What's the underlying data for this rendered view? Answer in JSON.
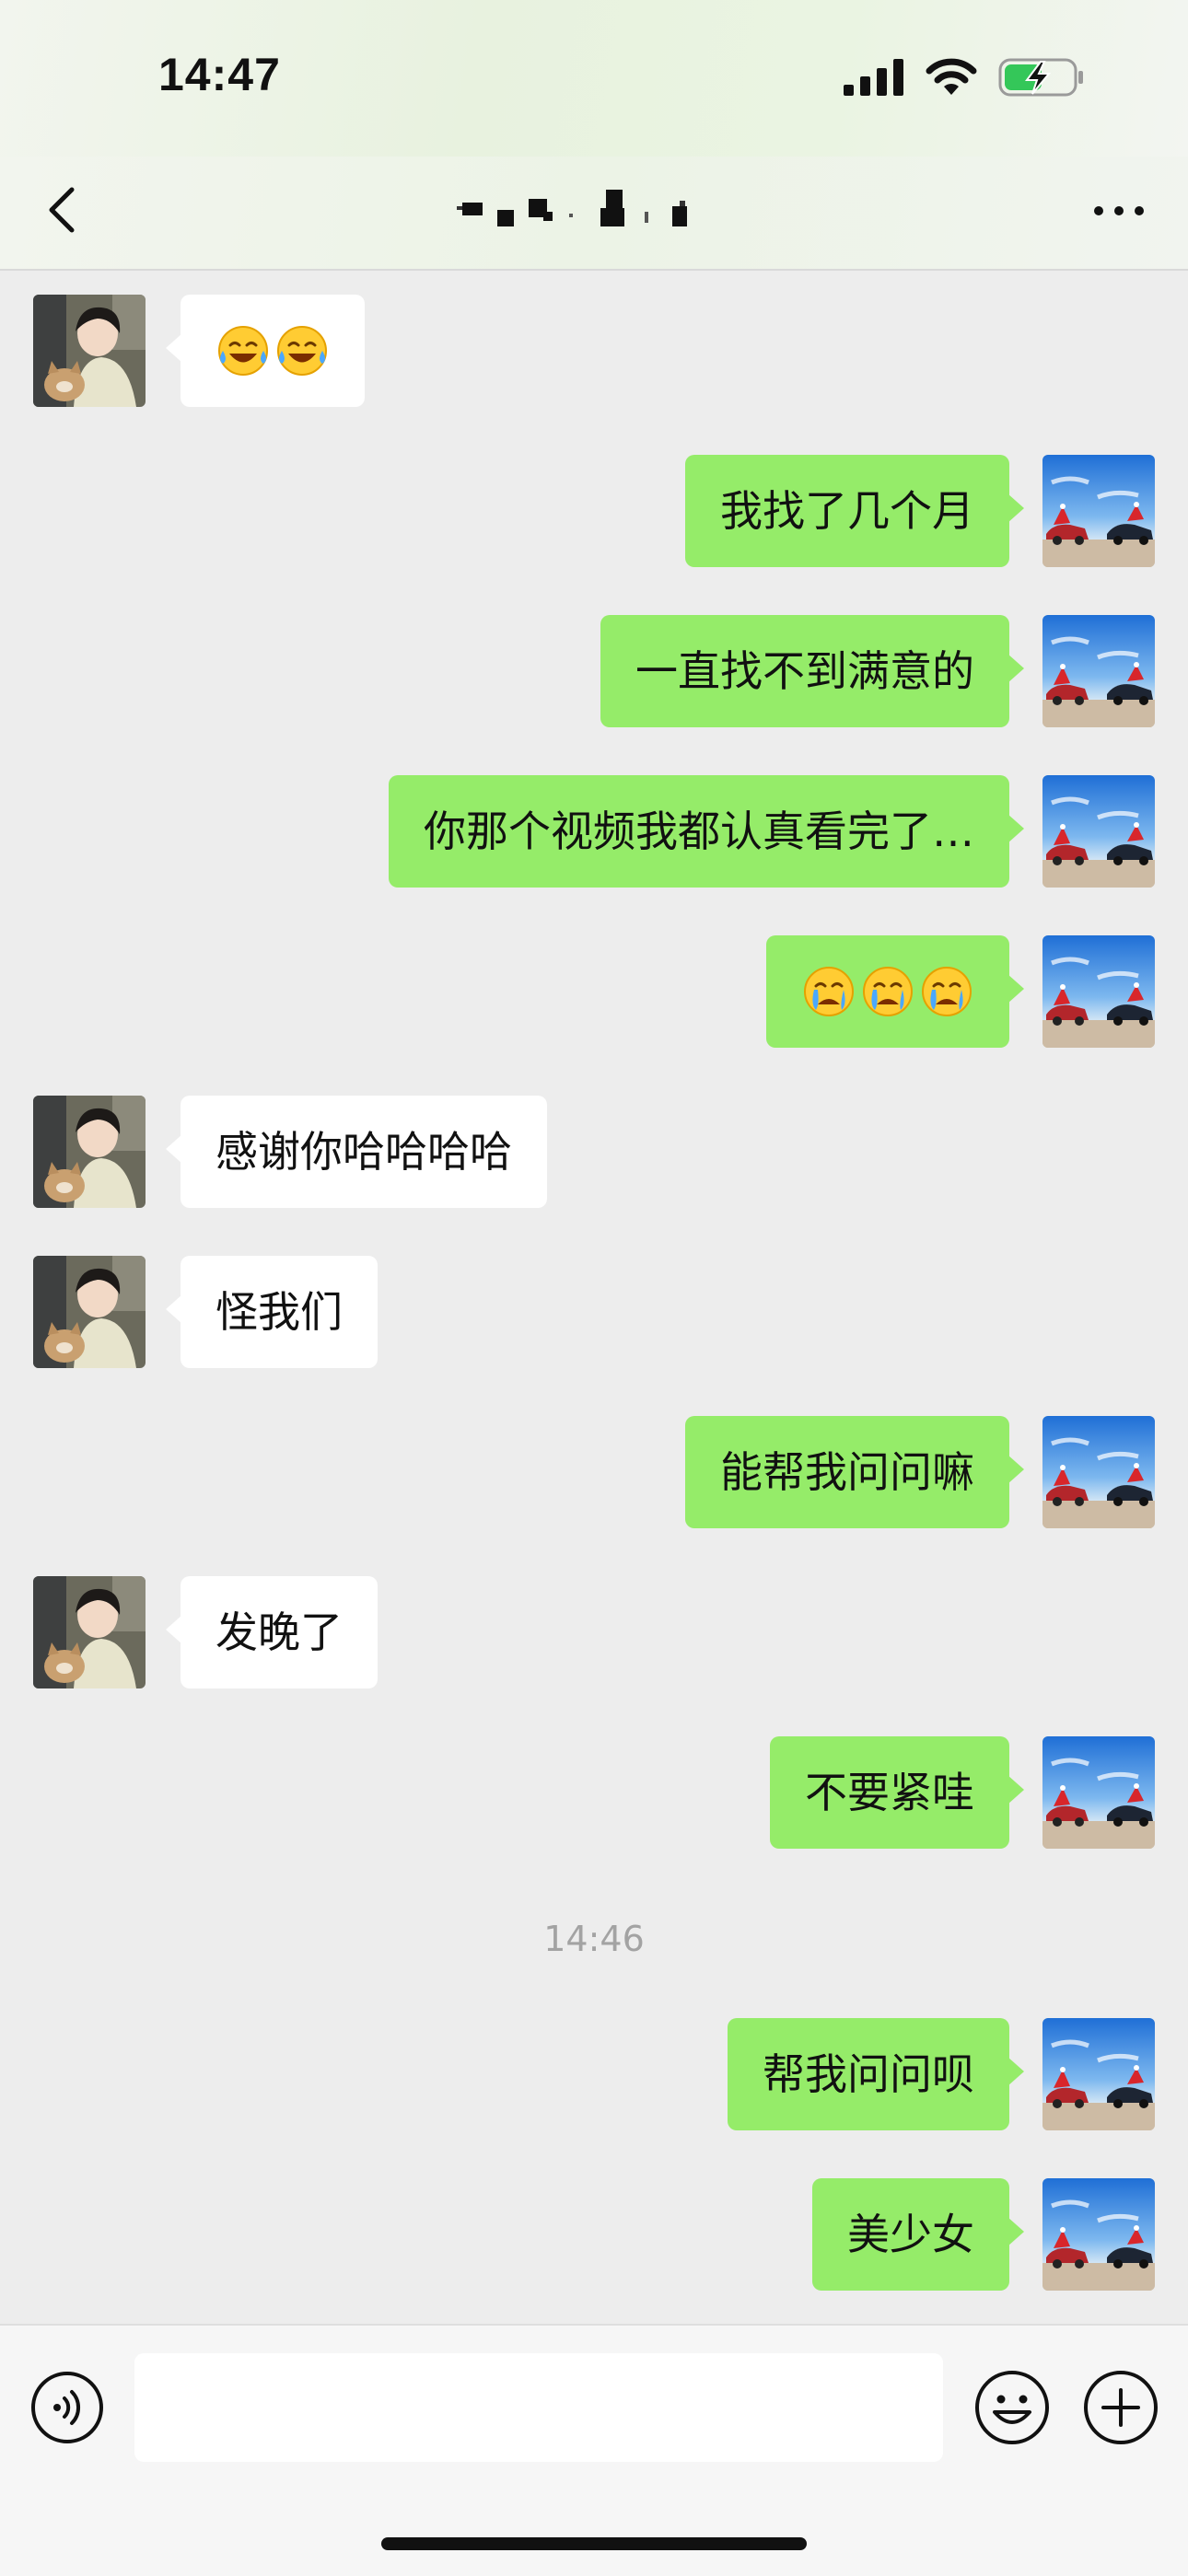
{
  "status_bar": {
    "time": "14:47"
  },
  "nav": {
    "title": ""
  },
  "messages": [
    {
      "side": "left",
      "type": "emoji",
      "emojis": [
        "😂",
        "😂"
      ]
    },
    {
      "side": "right",
      "type": "text",
      "text": "我找了几个月"
    },
    {
      "side": "right",
      "type": "text",
      "text": "一直找不到满意的"
    },
    {
      "side": "right",
      "type": "text",
      "text": "你那个视频我都认真看完了…"
    },
    {
      "side": "right",
      "type": "emoji",
      "emojis": [
        "😭",
        "😭",
        "😭"
      ]
    },
    {
      "side": "left",
      "type": "text",
      "text": "感谢你哈哈哈哈"
    },
    {
      "side": "left",
      "type": "text",
      "text": "怪我们"
    },
    {
      "side": "right",
      "type": "text",
      "text": "能帮我问问嘛"
    },
    {
      "side": "left",
      "type": "text",
      "text": "发晚了"
    },
    {
      "side": "right",
      "type": "text",
      "text": "不要紧哇"
    },
    {
      "side": "right",
      "type": "text",
      "text": "帮我问问呗"
    },
    {
      "side": "right",
      "type": "text",
      "text": "美少女"
    }
  ],
  "timestamp": "14:46",
  "input": {
    "value": "",
    "placeholder": ""
  },
  "colors": {
    "sent_bubble": "#95ec69",
    "received_bubble": "#ffffff",
    "background": "#ededed"
  }
}
